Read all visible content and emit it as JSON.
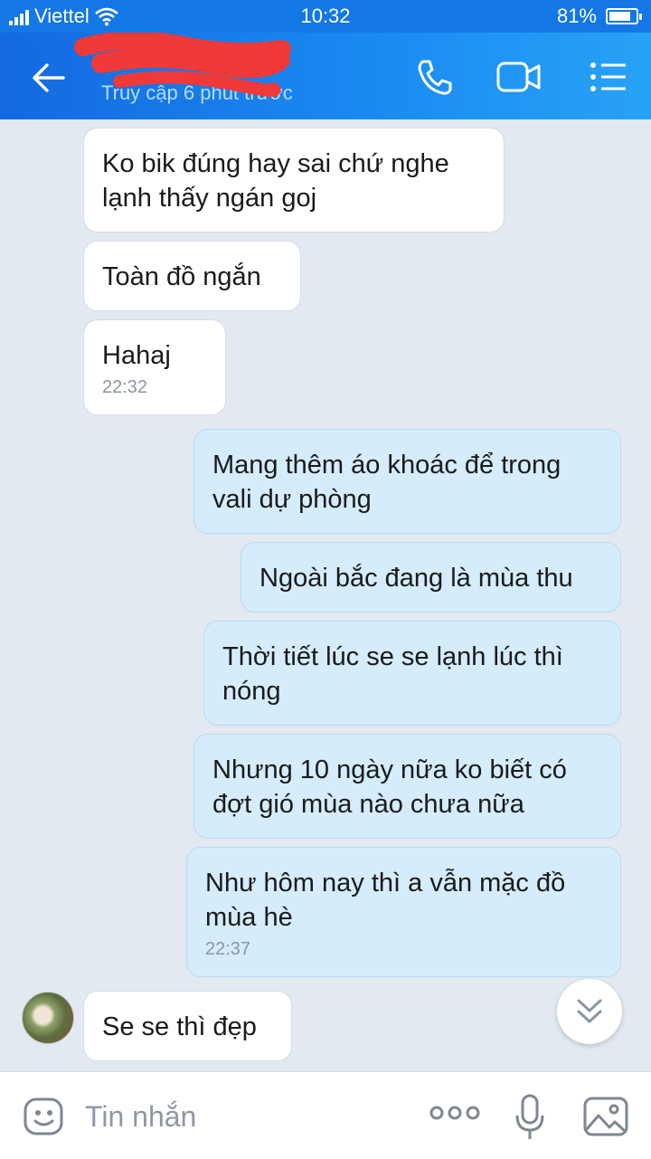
{
  "status_bar": {
    "carrier": "Viettel",
    "time": "10:32",
    "battery": "81%",
    "battery_level": 0.81
  },
  "header": {
    "contact_name": "",
    "status": "Truy cập 6 phút trước"
  },
  "messages": [
    {
      "dir": "in",
      "text": "Ko bik đúng hay sai chứ nghe lạnh thấy ngán goj",
      "time": ""
    },
    {
      "dir": "in",
      "text": "Toàn đồ ngắn",
      "time": ""
    },
    {
      "dir": "in",
      "text": "Hahaj",
      "time": "22:32"
    },
    {
      "dir": "out",
      "text": "Mang thêm áo khoác để trong vali dự phòng",
      "time": ""
    },
    {
      "dir": "out",
      "text": "Ngoài bắc đang là mùa thu",
      "time": ""
    },
    {
      "dir": "out",
      "text": "Thời tiết lúc se se lạnh lúc thì nóng",
      "time": ""
    },
    {
      "dir": "out",
      "text": "Nhưng 10 ngày nữa ko biết có đợt gió mùa nào chưa nữa",
      "time": ""
    },
    {
      "dir": "out",
      "text": "Như hôm nay thì a vẫn mặc đồ mùa hè",
      "time": "22:37"
    },
    {
      "dir": "in",
      "text": "Se se thì đẹp",
      "time": ""
    }
  ],
  "input": {
    "placeholder": "Tin nhắn"
  },
  "colors": {
    "header_start": "#1469e0",
    "header_end": "#27a3f6",
    "outgoing_bubble": "#d4ecfc",
    "incoming_bubble": "#ffffff",
    "chat_background": "#e2e9f1"
  },
  "icons": {
    "back": "arrow-left-icon",
    "call": "phone-icon",
    "video": "video-camera-icon",
    "menu": "list-menu-icon",
    "emoji": "emoji-icon",
    "more": "more-dots-icon",
    "mic": "microphone-icon",
    "image": "image-icon",
    "scroll": "double-chevron-down-icon"
  }
}
